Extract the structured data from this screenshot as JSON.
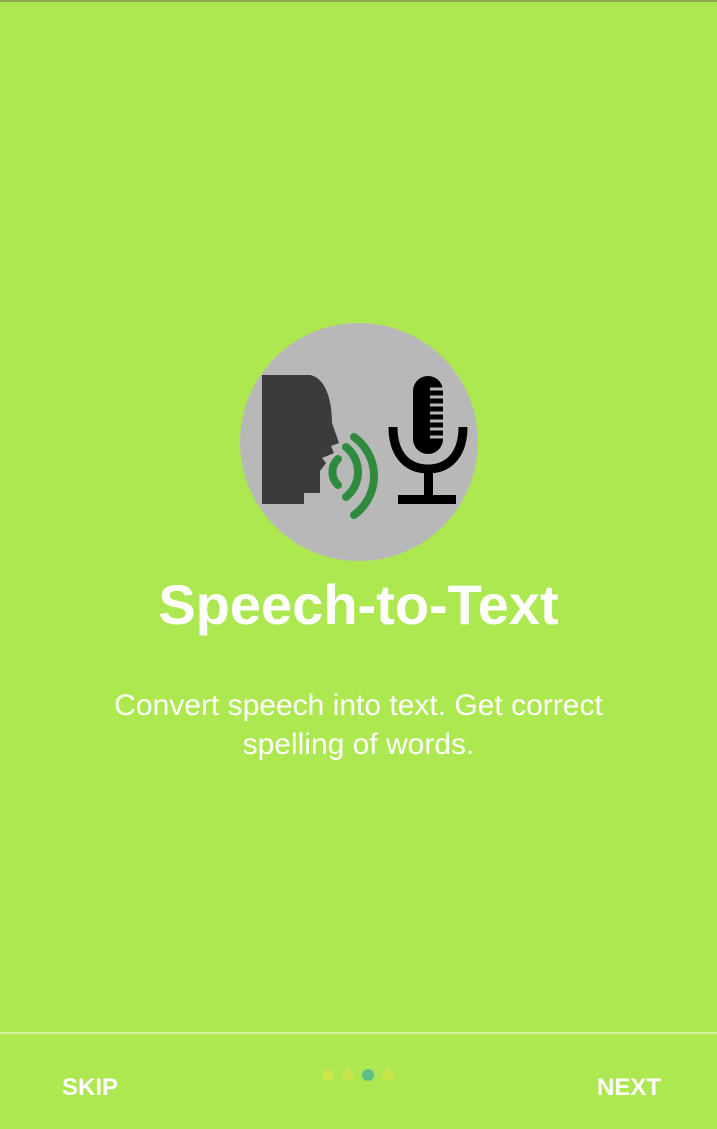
{
  "onboarding": {
    "title": "Speech-to-Text",
    "description": "Convert speech into text. Get correct spelling of words.",
    "hero_icon": "speaking-head-microphone-icon"
  },
  "footer": {
    "skip_label": "SKIP",
    "next_label": "NEXT",
    "page_count": 4,
    "current_page": 3
  },
  "colors": {
    "background": "#ade851",
    "hero_circle": "#b8b8b8",
    "head": "#3b3b3d",
    "sound_waves": "#2e8b3e",
    "microphone": "#000000",
    "dot_inactive": "#c8e64a",
    "dot_active": "#5bbf8a"
  }
}
